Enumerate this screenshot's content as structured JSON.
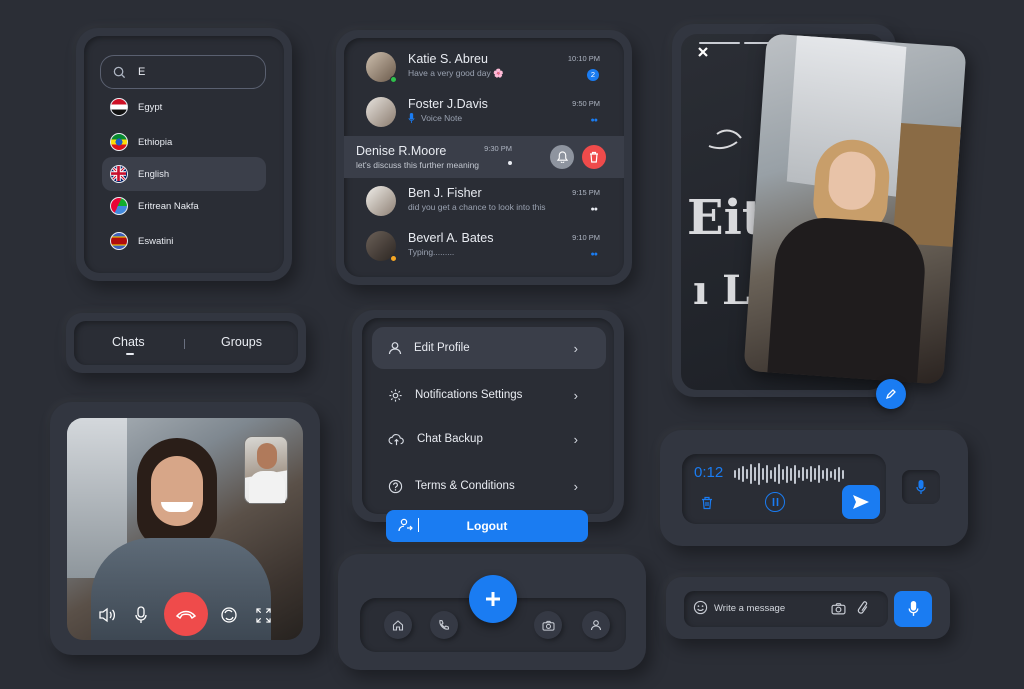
{
  "countries": {
    "search_value": "E",
    "items": [
      {
        "name": "Egypt"
      },
      {
        "name": "Ethiopia"
      },
      {
        "name": "English"
      },
      {
        "name": "Eritrean Nakfa"
      },
      {
        "name": "Eswatini"
      }
    ],
    "selected_index": 2
  },
  "chats": [
    {
      "name": "Katie S. Abreu",
      "message": "Have a very good day 🌸",
      "time": "10:10 PM",
      "unread": "2",
      "status": "online"
    },
    {
      "name": "Foster J.Davis",
      "message": "Voice Note",
      "time": "9:50 PM",
      "status": "read"
    },
    {
      "name": "Denise R.Moore",
      "message": "let's discuss this further meaning",
      "time": "9:30 PM",
      "status": "swiped"
    },
    {
      "name": "Ben J. Fisher",
      "message": "did you get a chance to look into this",
      "time": "9:15 PM",
      "status": "read"
    },
    {
      "name": "Beverl A. Bates",
      "message": "Typing.........",
      "time": "9:10 PM",
      "status": "away"
    }
  ],
  "tabs": {
    "chats": "Chats",
    "groups": "Groups",
    "active": "Chats"
  },
  "settings": {
    "items": [
      {
        "label": "Edit Profile",
        "icon": "user-icon"
      },
      {
        "label": "Notifications Settings",
        "icon": "gear-icon"
      },
      {
        "label": "Chat Backup",
        "icon": "cloud-upload-icon"
      },
      {
        "label": "Terms & Conditions",
        "icon": "question-icon"
      }
    ],
    "logout": "Logout"
  },
  "voice": {
    "duration": "0:12"
  },
  "composer": {
    "placeholder": "Write a message"
  },
  "colors": {
    "accent": "#1a7cf2",
    "danger": "#ef4b4b",
    "background": "#2b2e36",
    "card": "#323640"
  }
}
